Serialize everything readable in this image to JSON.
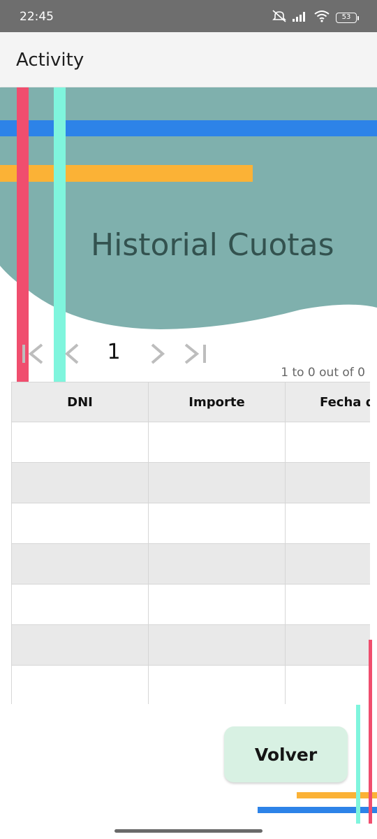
{
  "status_bar": {
    "time": "22:45",
    "battery": "53",
    "icons": [
      "mute-icon",
      "signal-icon",
      "wifi-icon",
      "battery-icon"
    ]
  },
  "app_bar": {
    "title": "Activity"
  },
  "hero": {
    "title": "Historial Cuotas",
    "background_color": "#7fb0ad"
  },
  "pagination": {
    "current_page": "1",
    "info": "1 to 0 out of 0",
    "controls": [
      "first-page-icon",
      "prev-page-icon",
      "next-page-icon",
      "last-page-icon"
    ]
  },
  "table": {
    "columns": [
      "DNI",
      "Importe",
      "Fecha del"
    ],
    "row_count": 7,
    "rows": []
  },
  "actions": {
    "back_label": "Volver"
  },
  "colors": {
    "red": "#f04e6e",
    "mint": "#7ff5dd",
    "blue": "#2d83e8",
    "orange": "#fbb236",
    "button_bg": "#d8f1e3"
  }
}
